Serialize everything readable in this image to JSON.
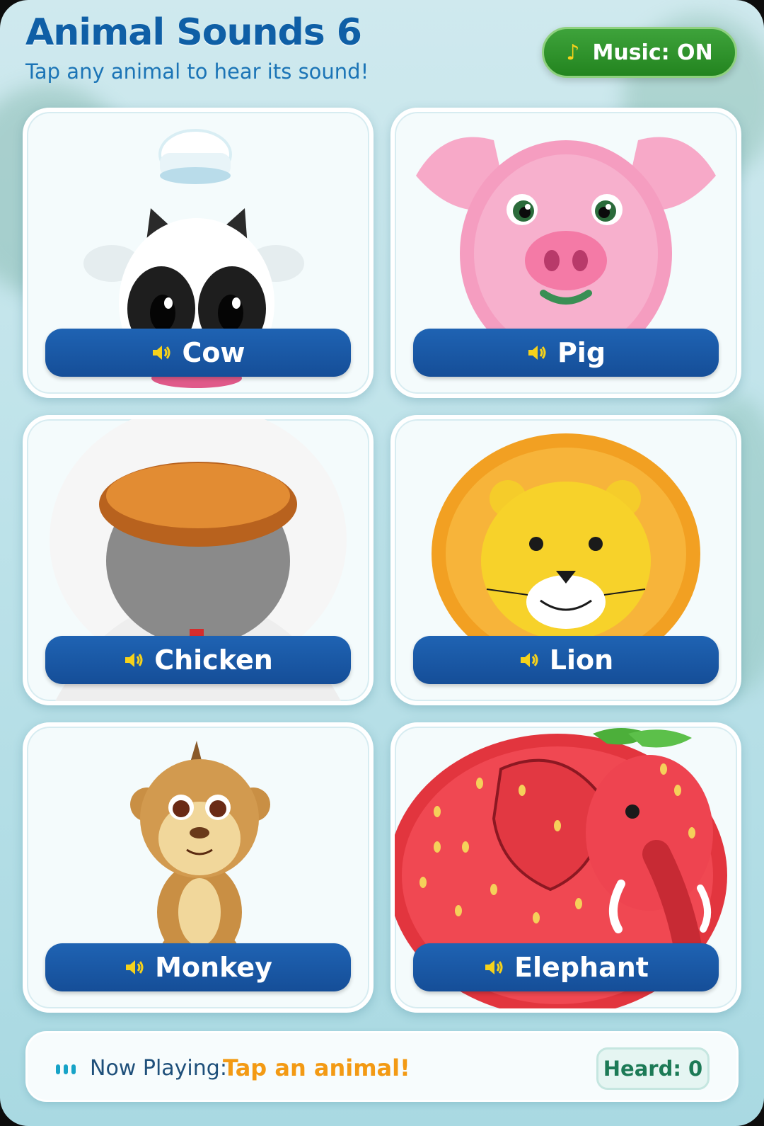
{
  "header": {
    "title": "Animal Sounds 6",
    "subtitle": "Tap any animal to hear its sound!",
    "music_label": "Music: ON",
    "music_icon": "music-note-icon"
  },
  "animals": [
    {
      "name": "Cow",
      "icon": "speaker-icon"
    },
    {
      "name": "Pig",
      "icon": "speaker-icon"
    },
    {
      "name": "Chicken",
      "icon": "speaker-icon"
    },
    {
      "name": "Lion",
      "icon": "speaker-icon"
    },
    {
      "name": "Monkey",
      "icon": "speaker-icon"
    },
    {
      "name": "Elephant",
      "icon": "speaker-icon"
    }
  ],
  "footer": {
    "now_playing_label": "Now Playing:",
    "now_playing_value": "Tap an animal!",
    "heard_label": "Heard: 0"
  },
  "colors": {
    "title": "#0f5fa6",
    "label_bar": "#1a5aa8",
    "music_button": "#2e9a2b",
    "now_playing_value": "#f39a14",
    "heard_text": "#1c7a56"
  }
}
